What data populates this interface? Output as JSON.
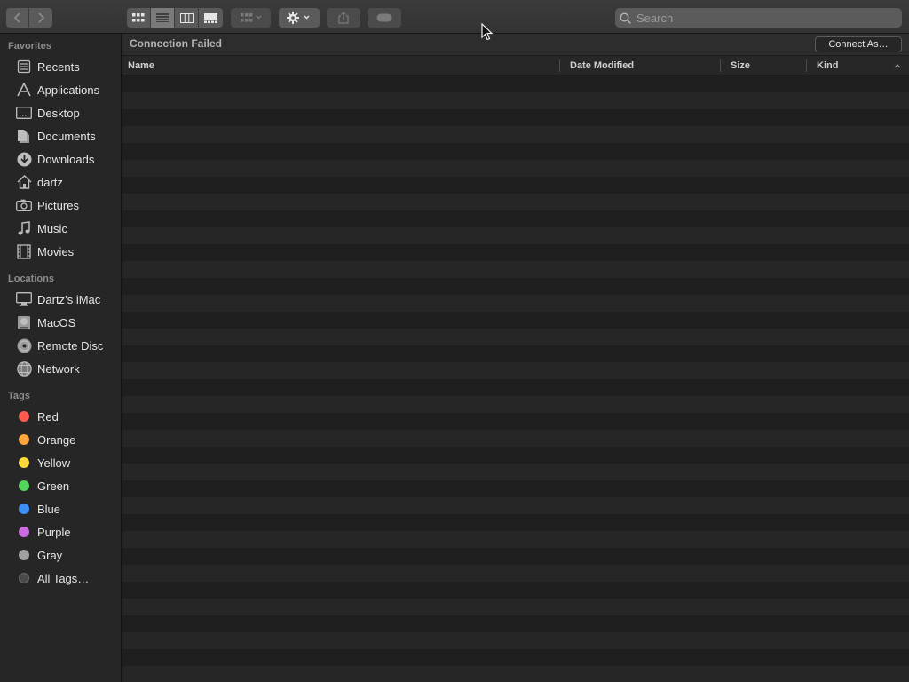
{
  "toolbar": {
    "search_placeholder": "Search"
  },
  "sidebar": {
    "sections": [
      {
        "title": "Favorites",
        "items": [
          {
            "label": "Recents",
            "icon": "recents-icon"
          },
          {
            "label": "Applications",
            "icon": "applications-icon"
          },
          {
            "label": "Desktop",
            "icon": "desktop-icon"
          },
          {
            "label": "Documents",
            "icon": "documents-icon"
          },
          {
            "label": "Downloads",
            "icon": "downloads-icon"
          },
          {
            "label": "dartz",
            "icon": "home-icon"
          },
          {
            "label": "Pictures",
            "icon": "camera-icon"
          },
          {
            "label": "Music",
            "icon": "music-note-icon"
          },
          {
            "label": "Movies",
            "icon": "film-icon"
          }
        ]
      },
      {
        "title": "Locations",
        "items": [
          {
            "label": "Dartz’s iMac",
            "icon": "imac-icon"
          },
          {
            "label": "MacOS",
            "icon": "hard-disk-icon"
          },
          {
            "label": "Remote Disc",
            "icon": "disc-icon"
          },
          {
            "label": "Network",
            "icon": "globe-icon"
          }
        ]
      },
      {
        "title": "Tags",
        "items": [
          {
            "label": "Red",
            "color": "#ff5a52"
          },
          {
            "label": "Orange",
            "color": "#ffa63d"
          },
          {
            "label": "Yellow",
            "color": "#ffd83b"
          },
          {
            "label": "Green",
            "color": "#4fd65b"
          },
          {
            "label": "Blue",
            "color": "#3b8ff7"
          },
          {
            "label": "Purple",
            "color": "#c86ce0"
          },
          {
            "label": "Gray",
            "color": "#a1a1a1"
          },
          {
            "label": "All Tags…",
            "color": "#4a4a4a"
          }
        ]
      }
    ]
  },
  "main": {
    "status_title": "Connection Failed",
    "connect_button": "Connect As…",
    "columns": [
      "Name",
      "Date Modified",
      "Size",
      "Kind"
    ]
  }
}
